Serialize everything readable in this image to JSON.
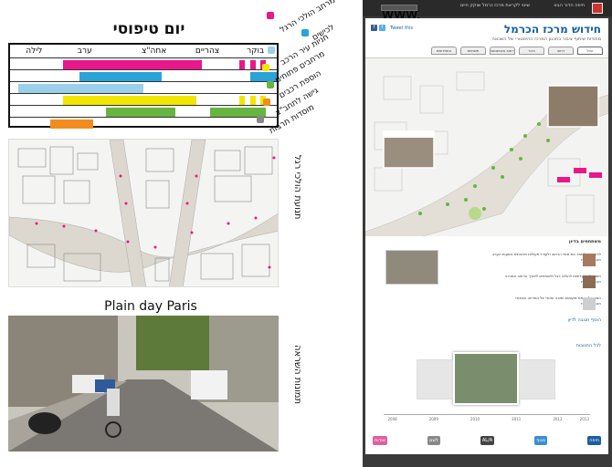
{
  "left": {
    "day_title": "יום טיפוסי",
    "schedule_headers": [
      "בוקר",
      "צהריים",
      "אחה\"צ",
      "ערב",
      "לילה"
    ],
    "legend": [
      {
        "label": "מרחב הולכי הרגל",
        "color": "#e8178a",
        "icon": "pedestrian-icon"
      },
      {
        "label": "לכישים",
        "color": "#2aa3d8",
        "icon": "bicycle-icon"
      },
      {
        "label": "חניות עיר הרכב",
        "color": "#9ad0ea",
        "icon": "car-icon"
      },
      {
        "label": "מרחבים פתוחים",
        "color": "#f2e600",
        "icon": "bench-icon"
      },
      {
        "label": "הוספת רכבים",
        "color": "#67b540",
        "icon": "tree-icon"
      },
      {
        "label": "גישה לתחב\"צ",
        "color": "#f28c1e",
        "icon": "bus-icon"
      },
      {
        "label": "מוסדות תרבות",
        "color": "#888888",
        "icon": "building-icon"
      }
    ],
    "schedule_rows": [
      {
        "bars": [
          {
            "from": 0.2,
            "to": 0.72,
            "color": "#e8178a"
          },
          {
            "from": 0.86,
            "to": 0.88,
            "color": "#e8178a"
          },
          {
            "from": 0.9,
            "to": 0.92,
            "color": "#e8178a"
          },
          {
            "from": 0.94,
            "to": 0.96,
            "color": "#e8178a"
          }
        ]
      },
      {
        "bars": [
          {
            "from": 0.26,
            "to": 0.57,
            "color": "#2aa3d8"
          },
          {
            "from": 0.9,
            "to": 1.0,
            "color": "#2aa3d8"
          }
        ]
      },
      {
        "bars": [
          {
            "from": 0.03,
            "to": 0.5,
            "color": "#9ad0ea"
          }
        ]
      },
      {
        "bars": [
          {
            "from": 0.2,
            "to": 0.7,
            "color": "#f2e600"
          },
          {
            "from": 0.86,
            "to": 0.88,
            "color": "#f2e600"
          },
          {
            "from": 0.9,
            "to": 0.92,
            "color": "#f2e600"
          },
          {
            "from": 0.94,
            "to": 0.96,
            "color": "#f2e600"
          }
        ]
      },
      {
        "bars": [
          {
            "from": 0.36,
            "to": 0.62,
            "color": "#67b540"
          },
          {
            "from": 0.75,
            "to": 0.96,
            "color": "#67b540"
          }
        ]
      },
      {
        "bars": [
          {
            "from": 0.15,
            "to": 0.31,
            "color": "#f28c1e"
          }
        ]
      }
    ],
    "map_label": "תנועת הולכי רגל",
    "paris_title": "Plain day Paris",
    "photo_label": "תמונות השראה"
  },
  "browser": {
    "topbar_left": "www.",
    "topbar_right_1": "חיפה הדור הבא",
    "topbar_right_2": "שינוי לקראת מרכז כרמל שוקק חיים",
    "page_title": "חידוש מרכז הכרמל",
    "page_subtitle": "מתודות שיתוף ציבור בתכנון המרכז ההיסטורי של השכונה",
    "share_text": "Tweet this",
    "tabs": [
      "הכל",
      "רחוב",
      "כיכר",
      "רחוב אנטיגונוס",
      "תשתיות",
      "התחדשות"
    ],
    "comments_title": "משתתפים בדיון",
    "comments": [
      {
        "text": "לדעתי יש לשמר את אופי הרחוב ולעודד פעילות תרבותית בשעות הערב",
        "link": "תגובה נוספת"
      },
      {
        "text": "חשוב לתת עדיפות להולכי רגל ולאופניים לאורך הרחוב המרכזי",
        "link": "תגובה נוספת"
      },
      {
        "text": "הצעה להוספת מקומות ישיבה ואזורי צל במרחב הציבורי",
        "link": "תגובה נוספת"
      }
    ],
    "note_1": "הוסף תגובה לדיון",
    "note_2": "לכל התגובות",
    "timeline_labels": [
      "2008",
      "2009",
      "2010",
      "2011",
      "2012",
      "2013"
    ],
    "logos": [
      {
        "label": "חיפה",
        "color": "#1a5fa0"
      },
      {
        "label": "מנוף",
        "color": "#3b8ed0"
      },
      {
        "label": "AL/A",
        "color": "#444444"
      },
      {
        "label": "לשם",
        "color": "#888888"
      },
      {
        "label": "אודות",
        "color": "#e05fa0"
      }
    ]
  }
}
